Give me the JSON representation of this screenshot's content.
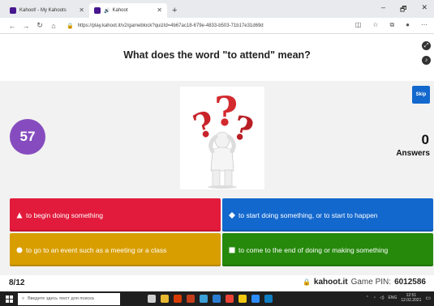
{
  "browser": {
    "tabs": [
      {
        "label": "Kahoot! - My Kahoots",
        "active": false
      },
      {
        "label": "Kahoot",
        "active": true
      }
    ],
    "new_tab": "+",
    "window_controls": [
      "–",
      "🗗",
      "✕"
    ],
    "url": "https://play.kahoot.it/v2/gameblock?quizId=4b67ac18-679e-4833-b503-71b17e31d69d"
  },
  "question": {
    "text": "What does the word \"to attend\" mean?"
  },
  "timer": {
    "value": "57"
  },
  "skip_label": "Skip",
  "answers_panel": {
    "count": "0",
    "label": "Answers"
  },
  "answers": [
    {
      "shape": "triangle",
      "text": "to begin doing something",
      "color": "#e21b3c"
    },
    {
      "shape": "diamond",
      "text": "to start doing something, or to start to happen",
      "color": "#1368ce"
    },
    {
      "shape": "circle",
      "text": "to go to an event such as a meeting or a class",
      "color": "#d89e00"
    },
    {
      "shape": "square",
      "text": "to come to the end of doing or making something",
      "color": "#26890c"
    }
  ],
  "footer": {
    "progress": "8/12",
    "site": "kahoot.it",
    "game_pin_label": "Game PIN:",
    "game_pin": "6012586"
  },
  "taskbar": {
    "search_placeholder": "Введите здесь текст для поиска",
    "lang": "ENG",
    "time": "12:51",
    "date": "12.02.2021"
  },
  "colors": {
    "timer": "#864cbf",
    "skip": "#1368ce",
    "play_area": "#f2f2f2"
  }
}
